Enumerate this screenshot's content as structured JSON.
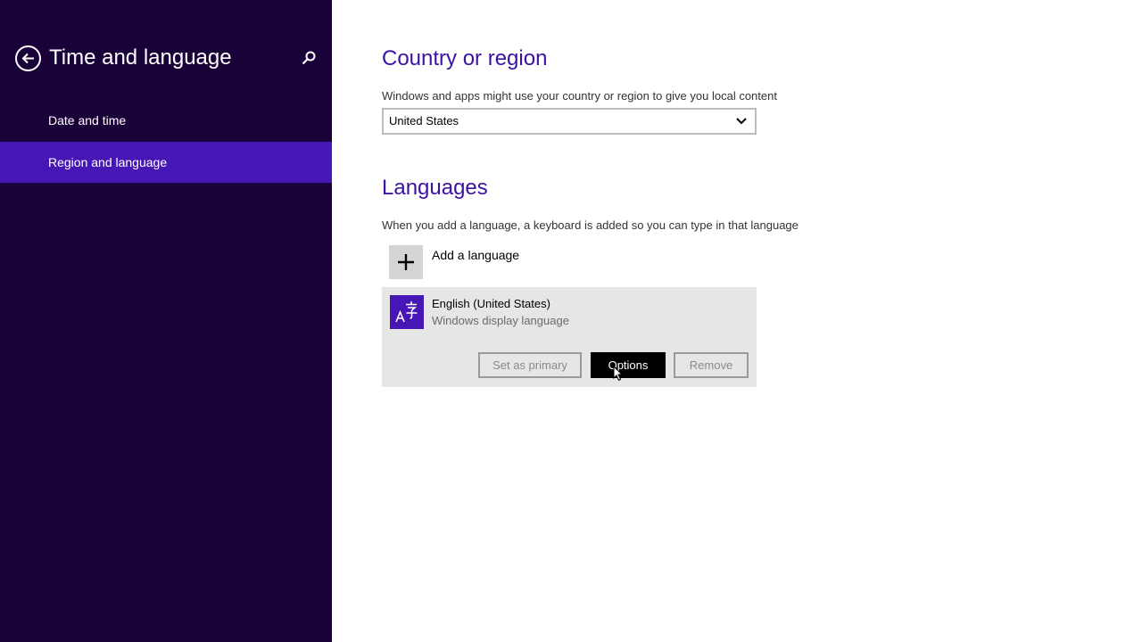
{
  "sidebar": {
    "title": "Time and language",
    "back_icon": "back-arrow-icon",
    "search_icon": "search-icon",
    "items": [
      {
        "label": "Date and time",
        "selected": false
      },
      {
        "label": "Region and language",
        "selected": true
      }
    ]
  },
  "country": {
    "title": "Country or region",
    "description": "Windows and apps might use your country or region to give you local content",
    "selected_value": "United States"
  },
  "languages": {
    "title": "Languages",
    "description": "When you add a language, a keyboard is added so you can type in that language",
    "add_label": "Add a language",
    "items": [
      {
        "name": "English (United States)",
        "subtitle": "Windows display language",
        "buttons": {
          "set_primary": "Set as primary",
          "options": "Options",
          "remove": "Remove"
        }
      }
    ]
  },
  "colors": {
    "sidebar_bg": "#180238",
    "accent": "#4617b4",
    "heading": "#3b12a3"
  }
}
